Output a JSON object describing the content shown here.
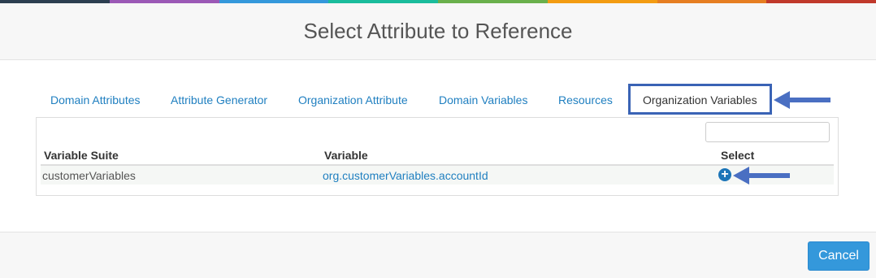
{
  "colors": {
    "strip": [
      "#2c3e50",
      "#9b59b6",
      "#3498db",
      "#1abc9c",
      "#6ab04c",
      "#f39c12",
      "#e67e22",
      "#c0392b"
    ],
    "accent": "#3498db",
    "link": "#1f7fc0",
    "annotation_arrow": "#4a6fc2"
  },
  "modal": {
    "title": "Select Attribute to Reference"
  },
  "tabs": [
    {
      "label": "Domain Attributes",
      "active": false
    },
    {
      "label": "Attribute Generator",
      "active": false
    },
    {
      "label": "Organization Attribute",
      "active": false
    },
    {
      "label": "Domain Variables",
      "active": false
    },
    {
      "label": "Resources",
      "active": false
    },
    {
      "label": "Organization Variables",
      "active": true
    }
  ],
  "search": {
    "value": "",
    "placeholder": ""
  },
  "table": {
    "columns": [
      "Variable Suite",
      "Variable",
      "Select"
    ],
    "rows": [
      {
        "variable_suite": "customerVariables",
        "variable": "org.customerVariables.accountId",
        "select_icon": "plus-circle-icon"
      }
    ]
  },
  "footer": {
    "cancel_label": "Cancel"
  }
}
